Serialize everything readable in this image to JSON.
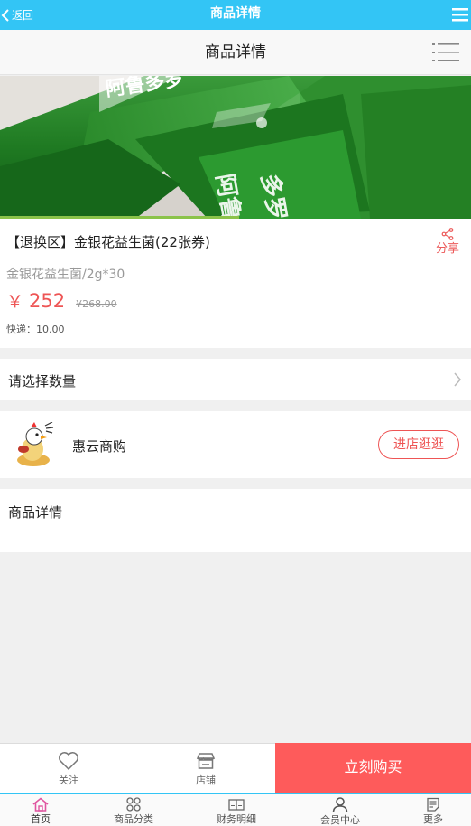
{
  "topbar": {
    "back_label": "返回",
    "title": "商品详情"
  },
  "header": {
    "title": "商品详情"
  },
  "product": {
    "image_text": "阿鲁多罗",
    "name": "【退换区】金银花益生菌(22张券)",
    "share_label": "分享",
    "spec": "金银花益生菌/2g*30",
    "currency": "￥",
    "price": "252",
    "original_price": "¥268.00",
    "shipping": "快递：10.00"
  },
  "quantity": {
    "label": "请选择数量"
  },
  "store": {
    "name": "惠云商购",
    "visit_label": "进店逛逛"
  },
  "details": {
    "label": "商品详情"
  },
  "actionbar": {
    "follow_label": "关注",
    "store_label": "店铺",
    "buy_label": "立刻购买"
  },
  "bottomnav": {
    "items": [
      {
        "label": "首页",
        "icon": "home-icon"
      },
      {
        "label": "商品分类",
        "icon": "grid-icon"
      },
      {
        "label": "财务明细",
        "icon": "book-icon"
      },
      {
        "label": "会员中心",
        "icon": "user-icon"
      },
      {
        "label": "更多",
        "icon": "notes-icon"
      }
    ]
  },
  "colors": {
    "topbar": "#33c5f5",
    "price": "#ee5555",
    "buy": "#fe5b5b"
  }
}
